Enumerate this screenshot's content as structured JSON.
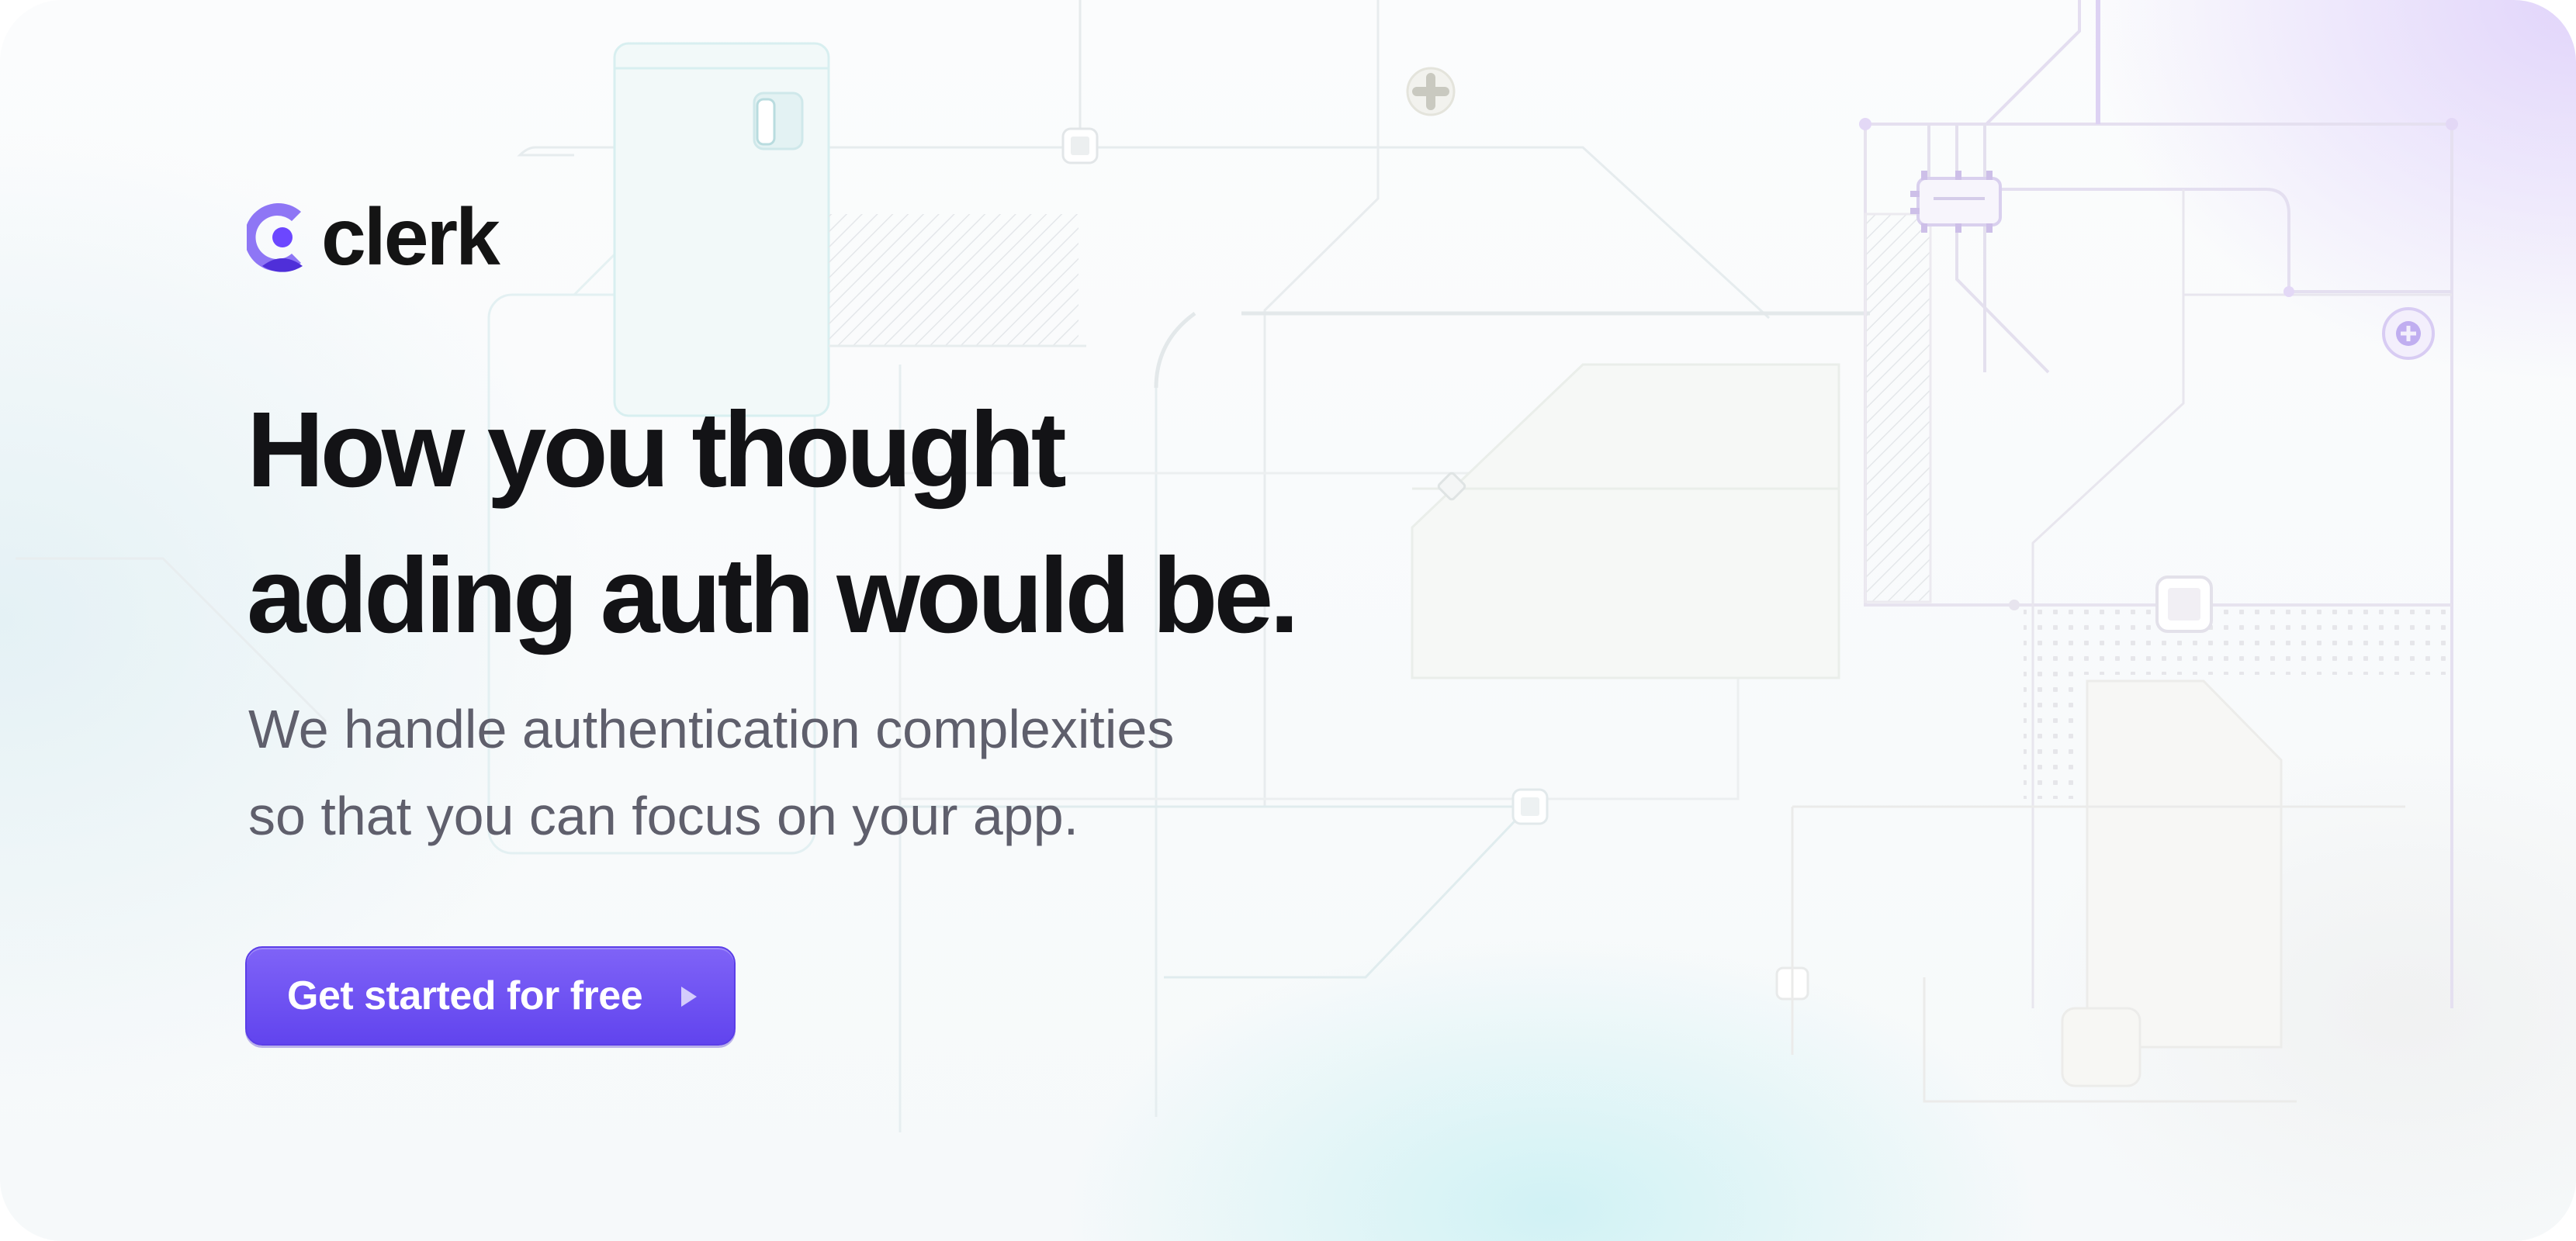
{
  "brand": {
    "name": "clerk",
    "accent": "#6c47ff"
  },
  "hero": {
    "headline_line1": "How you thought",
    "headline_line2": "adding auth would be.",
    "subtitle_line1": "We handle authentication complexities",
    "subtitle_line2": "so that you can focus on your app."
  },
  "cta": {
    "label": "Get started for free",
    "icon": "triangle-right-icon"
  },
  "background": {
    "graphic": "circuit-board-illustration"
  }
}
